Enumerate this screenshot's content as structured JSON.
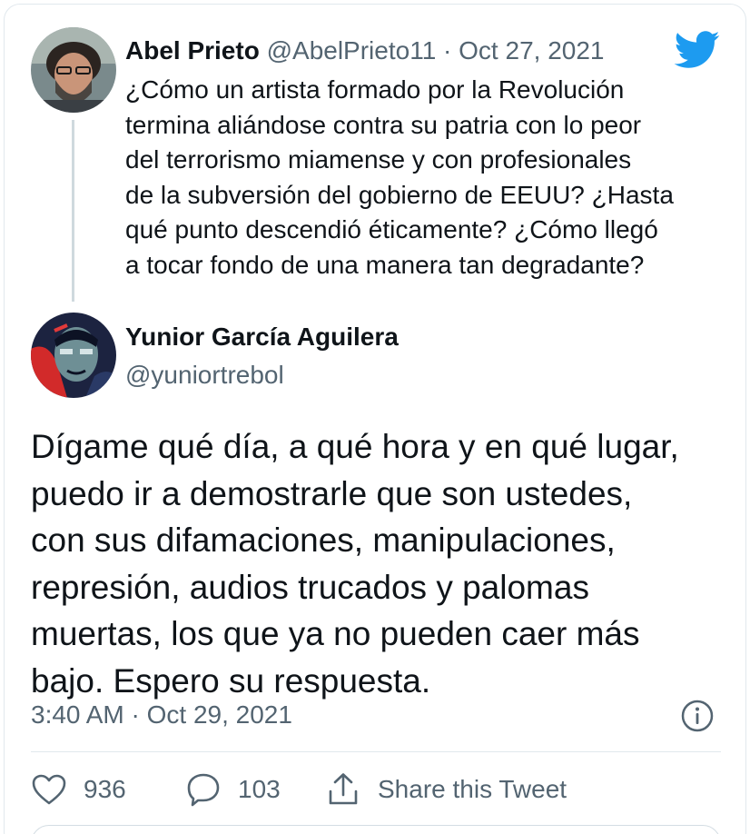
{
  "parent_tweet": {
    "author_name": "Abel Prieto",
    "meta": "@AbelPrieto11 · Oct 27, 2021",
    "text": "¿Cómo un artista formado por la Revolución\ntermina aliándose contra su patria con lo peor\ndel terrorismo miamense y con profesionales\nde la subversión del gobierno de EEUU? ¿Hasta\nqué punto descendió éticamente? ¿Cómo llegó\na tocar fondo de una manera tan degradante?"
  },
  "main_tweet": {
    "author_name": "Yunior García Aguilera",
    "handle": "@yuniortrebol",
    "text": "Dígame qué día, a qué hora y en qué lugar,\npuedo ir a demostrarle que son ustedes,\ncon sus difamaciones, manipulaciones,\nrepresión, audios trucados y palomas\nmuertas, los que ya no pueden caer más\nbajo. Espero su respuesta.",
    "timestamp": "3:40 AM · Oct 29, 2021"
  },
  "actions": {
    "likes": "936",
    "replies": "103",
    "share_label": "Share this Tweet"
  },
  "icons": {
    "twitter_logo": "twitter-bird-icon",
    "info": "info-icon",
    "like": "heart-icon",
    "reply": "speech-bubble-icon",
    "share": "share-upload-icon"
  },
  "colors": {
    "twitter_blue": "#1d9bf0",
    "secondary_text": "#536471",
    "primary_text": "#0f1419"
  }
}
